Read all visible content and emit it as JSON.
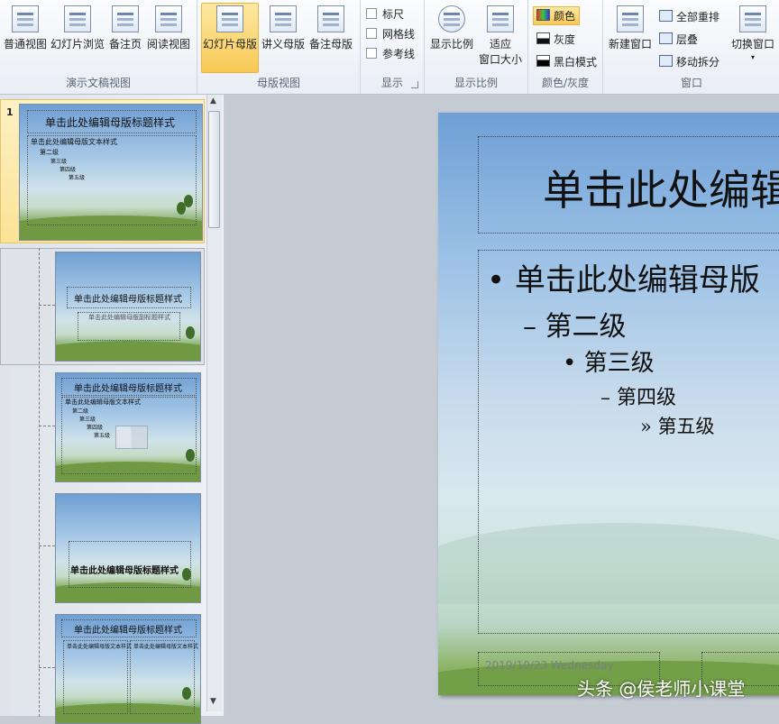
{
  "ribbon": {
    "groups": {
      "presentation_views": "演示文稿视图",
      "master_views": "母版视图",
      "show": "显示",
      "zoom": "显示比例",
      "color": "颜色/灰度",
      "window": "窗口"
    },
    "buttons": {
      "normal": "普通视图",
      "sorter": "幻灯片浏览",
      "notes_page": "备注页",
      "reading": "阅读视图",
      "slide_master": "幻灯片母版",
      "handout_master": "讲义母版",
      "notes_master": "备注母版",
      "zoom": "显示比例",
      "fit_line1": "适应",
      "fit_line2": "窗口大小",
      "new_window": "新建窗口",
      "switch_window": "切换窗口"
    },
    "checks": {
      "ruler": "标尺",
      "gridlines": "网格线",
      "guides": "参考线"
    },
    "color_options": {
      "color": "颜色",
      "grayscale": "灰度",
      "bw": "黑白模式"
    },
    "window_items": {
      "arrange_all": "全部重排",
      "cascade": "层叠",
      "move_split": "移动拆分"
    }
  },
  "thumbnails": {
    "slide_number": "1",
    "master_title": "单击此处编辑母版标题样式",
    "master_body": "单击此处编辑母版文本样式",
    "level2": "第二级",
    "level3": "第三级",
    "level4": "第四级",
    "level5": "第五级",
    "subtitle": "单击此处编辑母版副标题样式"
  },
  "slide": {
    "title": "单击此处编辑",
    "bullet1": "单击此处编辑母版",
    "bullet2": "第二级",
    "bullet3": "第三级",
    "bullet4": "第四级",
    "bullet5": "第五级",
    "date": "2019/10/23  Wednesday"
  },
  "watermark": "头条 @侯老师小课堂",
  "colors": {
    "accent_selected": "#f8c955",
    "ribbon_bg": "#e9eef5"
  }
}
